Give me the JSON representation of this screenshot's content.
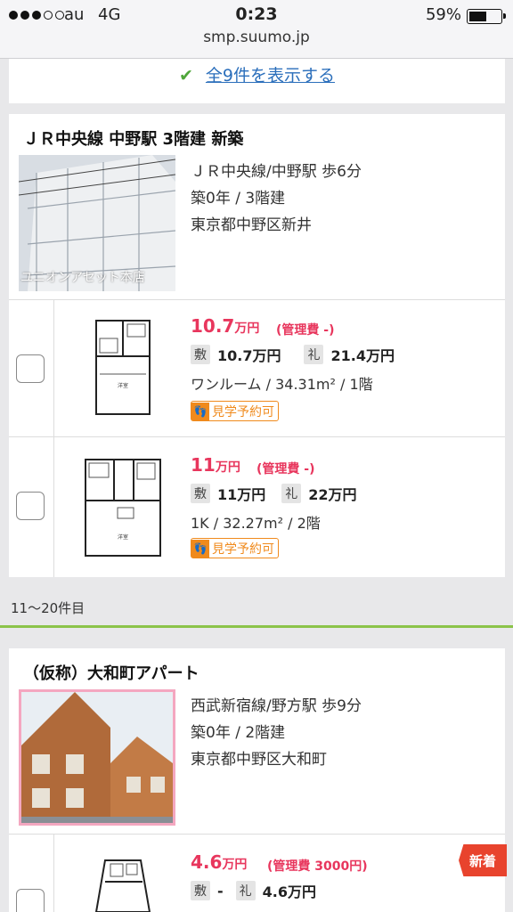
{
  "status_bar": {
    "carrier": "au",
    "network": "4G",
    "time": "0:23",
    "battery_percent": "59%",
    "battery_level": 0.59,
    "signal_bars_on": 3,
    "signal_bars_total": 5
  },
  "browser": {
    "url": "smp.suumo.jp"
  },
  "show_all_link": "全9件を表示する",
  "listings": [
    {
      "title": "ＪＲ中央線 中野駅 3階建 新築",
      "station": "ＪＲ中央線/中野駅 歩6分",
      "age_floors": "築0年 / 3階建",
      "address": "東京都中野区新井",
      "photo_caption": "ユニオンアセット本店",
      "rooms": [
        {
          "rent": "10.7",
          "rent_unit": "万円",
          "fee": "(管理費 -)",
          "deposit_label": "敷",
          "deposit": "10.7万円",
          "key_money_label": "礼",
          "key_money": "21.4万円",
          "layout": "ワンルーム / 34.31m² / 1階",
          "badge": "見学予約可"
        },
        {
          "rent": "11",
          "rent_unit": "万円",
          "fee": "(管理費 -)",
          "deposit_label": "敷",
          "deposit": "11万円",
          "key_money_label": "礼",
          "key_money": "22万円",
          "layout": "1K / 32.27m² / 2階",
          "badge": "見学予約可"
        }
      ]
    },
    {
      "title": "（仮称）大和町アパート",
      "station": "西武新宿線/野方駅 歩9分",
      "age_floors": "築0年 / 2階建",
      "address": "東京都中野区大和町",
      "rooms": [
        {
          "rent": "4.6",
          "rent_unit": "万円",
          "fee": "(管理費 3000円)",
          "deposit_label": "敷",
          "deposit": "-",
          "key_money_label": "礼",
          "key_money": "4.6万円",
          "new_label": "新着"
        }
      ]
    }
  ],
  "page_range": "11〜20件目",
  "colors": {
    "rent": "#e8365d",
    "link": "#2a6ebb",
    "accent_green": "#8bc34a",
    "badge_orange": "#f08a1c",
    "new_red": "#e8432d"
  }
}
